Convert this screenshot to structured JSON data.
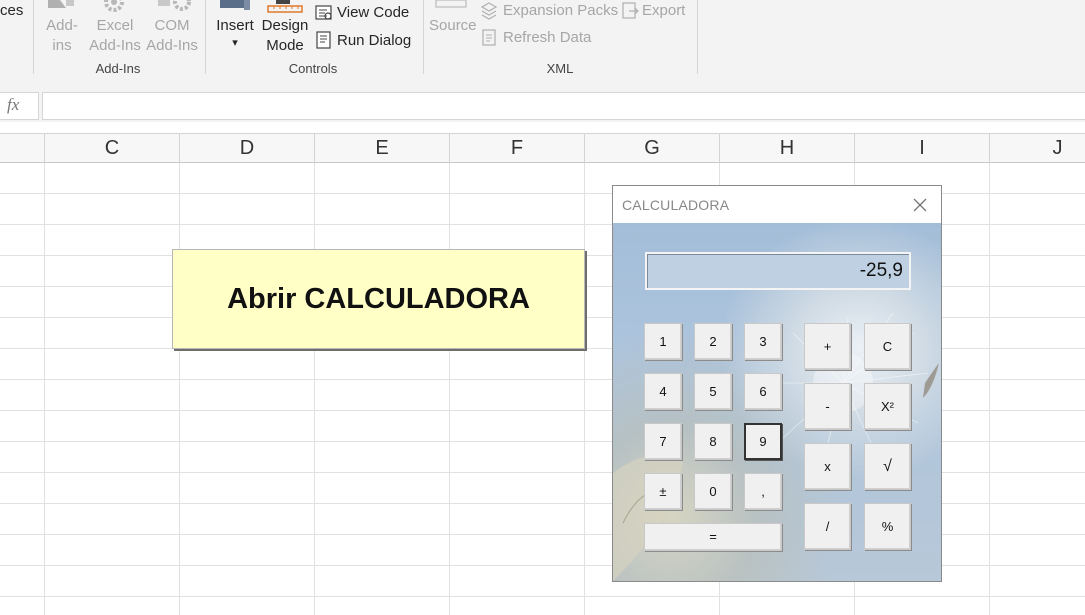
{
  "ribbon": {
    "partial_left": "ces",
    "addins": {
      "add_ins_line1": "Add-",
      "add_ins_line2": "ins",
      "excel_line1": "Excel",
      "excel_line2": "Add-Ins",
      "com_line1": "COM",
      "com_line2": "Add-Ins",
      "group": "Add-Ins"
    },
    "controls": {
      "insert": "Insert",
      "insert_arrow": "▾",
      "design_line1": "Design",
      "design_line2": "Mode",
      "view_code": "View Code",
      "run_dialog": "Run Dialog",
      "group": "Controls"
    },
    "xml": {
      "source": "Source",
      "expansion_packs": "Expansion Packs",
      "refresh_data": "Refresh Data",
      "export": "Export",
      "group": "XML"
    }
  },
  "formula_bar": {
    "fx": "fx",
    "value": ""
  },
  "columns": [
    "C",
    "D",
    "E",
    "F",
    "G",
    "H",
    "I",
    "J"
  ],
  "sheet_button": {
    "label": "Abrir CALCULADORA",
    "fill": "#ffffc6"
  },
  "calculator": {
    "title": "CALCULADORA",
    "display": "-25,9",
    "keys": {
      "k1": "1",
      "k2": "2",
      "k3": "3",
      "k4": "4",
      "k5": "5",
      "k6": "6",
      "k7": "7",
      "k8": "8",
      "k9": "9",
      "sign": "±",
      "k0": "0",
      "comma": ",",
      "equals": "=",
      "plus": "+",
      "clear": "C",
      "minus": "-",
      "square": "X²",
      "multiply": "x",
      "sqrt": "√",
      "divide": "/",
      "percent": "%"
    }
  }
}
